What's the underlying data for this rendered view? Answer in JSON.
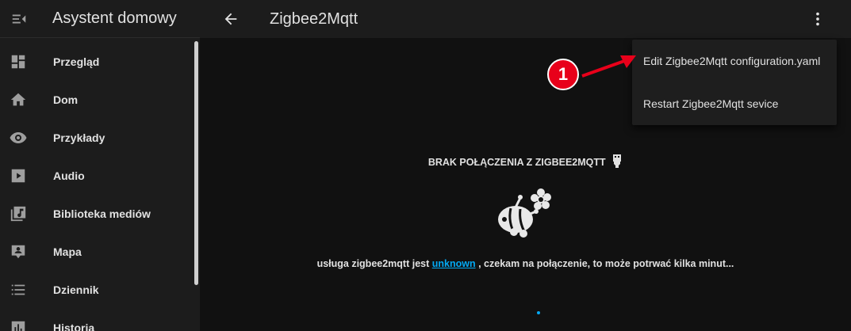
{
  "sidebar": {
    "title": "Asystent domowy",
    "items": [
      {
        "label": "Przegląd",
        "icon": "dashboard-icon"
      },
      {
        "label": "Dom",
        "icon": "home-icon"
      },
      {
        "label": "Przykłady",
        "icon": "eye-icon"
      },
      {
        "label": "Audio",
        "icon": "play-icon"
      },
      {
        "label": "Biblioteka mediów",
        "icon": "media-library-icon"
      },
      {
        "label": "Mapa",
        "icon": "map-icon"
      },
      {
        "label": "Dziennik",
        "icon": "list-icon"
      },
      {
        "label": "Historia",
        "icon": "chart-icon"
      }
    ]
  },
  "topbar": {
    "title": "Zigbee2Mqtt"
  },
  "menu": {
    "items": [
      {
        "label": "Edit Zigbee2Mqtt configuration.yaml"
      },
      {
        "label": "Restart Zigbee2Mqtt sevice"
      }
    ]
  },
  "main": {
    "connection_title": "BRAK POŁĄCZENIA Z ZIGBEE2MQTT",
    "status_prefix": "usługa zigbee2mqtt jest",
    "status_link": "unknown",
    "status_suffix": ", czekam na połączenie, to może potrwać kilka minut..."
  },
  "annotation": {
    "number": "1"
  },
  "colors": {
    "accent": "#03a9f4",
    "annotation_red": "#e8001a",
    "sidebar_bg": "#1c1c1c",
    "main_bg": "#111111"
  }
}
